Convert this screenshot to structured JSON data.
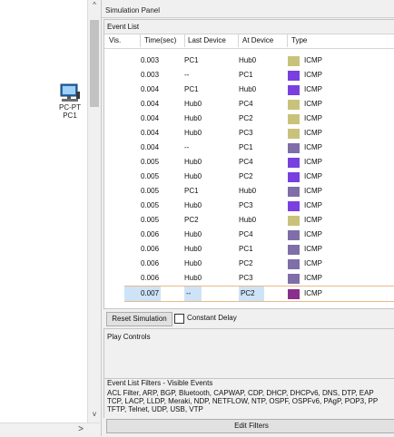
{
  "workspace": {
    "device": {
      "type_label": "PC-PT",
      "name_label": "PC1"
    },
    "vscroll": {
      "up": "^",
      "down": "v"
    },
    "hscroll": {
      "right": ">"
    }
  },
  "panel": {
    "title": "Simulation Panel",
    "event_list": {
      "title": "Event List",
      "columns": [
        "Vis.",
        "Time(sec)",
        "Last Device",
        "At Device",
        "Type"
      ],
      "rows": [
        {
          "time": "0.003",
          "last": "PC1",
          "at": "Hub0",
          "color": "#c9c27a",
          "type": "ICMP"
        },
        {
          "time": "0.003",
          "last": "--",
          "at": "PC1",
          "color": "#7a3fe0",
          "type": "ICMP"
        },
        {
          "time": "0.004",
          "last": "PC1",
          "at": "Hub0",
          "color": "#7a3fe0",
          "type": "ICMP"
        },
        {
          "time": "0.004",
          "last": "Hub0",
          "at": "PC4",
          "color": "#c9c27a",
          "type": "ICMP"
        },
        {
          "time": "0.004",
          "last": "Hub0",
          "at": "PC2",
          "color": "#c9c27a",
          "type": "ICMP"
        },
        {
          "time": "0.004",
          "last": "Hub0",
          "at": "PC3",
          "color": "#c9c27a",
          "type": "ICMP"
        },
        {
          "time": "0.004",
          "last": "--",
          "at": "PC1",
          "color": "#7f6ea8",
          "type": "ICMP"
        },
        {
          "time": "0.005",
          "last": "Hub0",
          "at": "PC4",
          "color": "#7a3fe0",
          "type": "ICMP"
        },
        {
          "time": "0.005",
          "last": "Hub0",
          "at": "PC2",
          "color": "#7a3fe0",
          "type": "ICMP"
        },
        {
          "time": "0.005",
          "last": "PC1",
          "at": "Hub0",
          "color": "#7f6ea8",
          "type": "ICMP"
        },
        {
          "time": "0.005",
          "last": "Hub0",
          "at": "PC3",
          "color": "#7a3fe0",
          "type": "ICMP"
        },
        {
          "time": "0.005",
          "last": "PC2",
          "at": "Hub0",
          "color": "#c9c27a",
          "type": "ICMP"
        },
        {
          "time": "0.006",
          "last": "Hub0",
          "at": "PC4",
          "color": "#7f6ea8",
          "type": "ICMP"
        },
        {
          "time": "0.006",
          "last": "Hub0",
          "at": "PC1",
          "color": "#7f6ea8",
          "type": "ICMP"
        },
        {
          "time": "0.006",
          "last": "Hub0",
          "at": "PC2",
          "color": "#7f6ea8",
          "type": "ICMP"
        },
        {
          "time": "0.006",
          "last": "Hub0",
          "at": "PC3",
          "color": "#7f6ea8",
          "type": "ICMP"
        },
        {
          "time": "0.007",
          "last": "--",
          "at": "PC2",
          "color": "#8a2f8a",
          "type": "ICMP"
        }
      ]
    },
    "reset_button": "Reset Simulation",
    "constant_delay": {
      "label": "Constant Delay",
      "checked": false
    },
    "play_controls": {
      "title": "Play Controls"
    },
    "filters": {
      "title": "Event List Filters - Visible Events",
      "lines": [
        "ACL Filter, ARP, BGP, Bluetooth, CAPWAP, CDP, DHCP, DHCPv6, DNS, DTP, EAP",
        "TCP, LACP, LLDP, Meraki, NDP, NETFLOW, NTP, OSPF, OSPFv6, PAgP, POP3, PP",
        "TFTP, Telnet, UDP, USB, VTP"
      ]
    },
    "edit_filters_button": "Edit Filters"
  }
}
